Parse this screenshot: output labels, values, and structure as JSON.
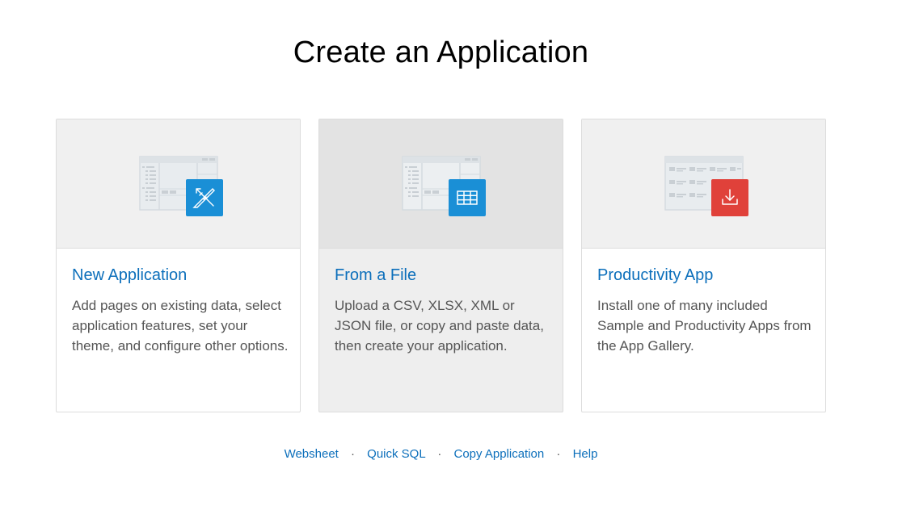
{
  "page": {
    "title": "Create an Application"
  },
  "cards": [
    {
      "title": "New Application",
      "description": "Add pages on existing data, select application features, set your theme, and configure other options.",
      "badge_icon": "pencil-ruler-icon",
      "badge_color": "#1a8fd6"
    },
    {
      "title": "From a File",
      "description": "Upload a CSV, XLSX, XML or JSON file, or copy and paste data, then create your application.",
      "badge_icon": "table-grid-icon",
      "badge_color": "#1a8fd6"
    },
    {
      "title": "Productivity App",
      "description": "Install one of many included Sample and Productivity Apps from the App Gallery.",
      "badge_icon": "download-icon",
      "badge_color": "#e0413a"
    }
  ],
  "footer": {
    "links": [
      "Websheet",
      "Quick SQL",
      "Copy Application",
      "Help"
    ],
    "separator": "·"
  },
  "colors": {
    "link": "#0c6fbb",
    "text": "#555555"
  }
}
